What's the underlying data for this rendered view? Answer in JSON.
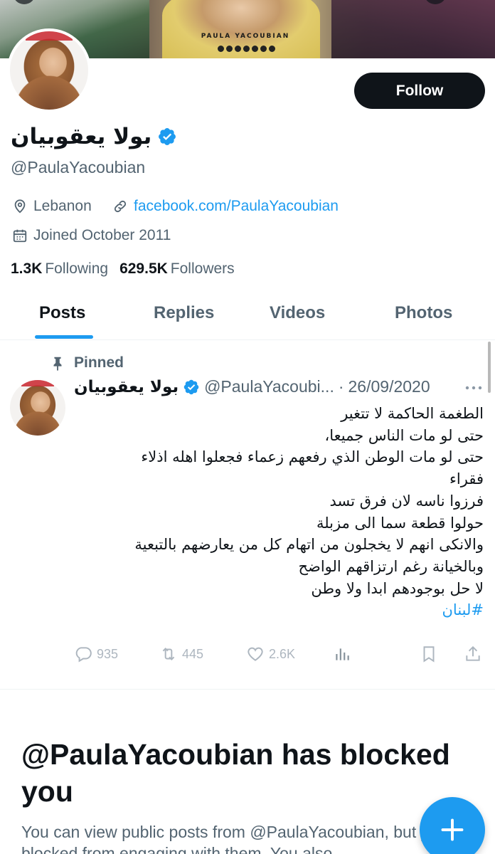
{
  "banner": {
    "brand_text": "PAULA YACOUBIAN"
  },
  "profile": {
    "display_name": "بولا يعقوبيان",
    "handle": "@PaulaYacoubian",
    "location": "Lebanon",
    "website": "facebook.com/PaulaYacoubian",
    "joined": "Joined October 2011",
    "following_count": "1.3K",
    "following_label": "Following",
    "followers_count": "629.5K",
    "followers_label": "Followers"
  },
  "follow_button": {
    "label": "Follow"
  },
  "tabs": [
    {
      "label": "Posts",
      "active": true
    },
    {
      "label": "Replies",
      "active": false
    },
    {
      "label": "Videos",
      "active": false
    },
    {
      "label": "Photos",
      "active": false
    }
  ],
  "pinned_post": {
    "pinned_label": "Pinned",
    "author_name": "بولا يعقوبيان",
    "author_handle": "@PaulaYacoubi...",
    "separator": "·",
    "date": "26/09/2020",
    "body_lines": [
      "الطغمة الحاكمة لا تتغير",
      "حتى لو مات الناس جميعا،",
      "حتى لو مات الوطن الذي رفعهم زعماء فجعلوا اهله اذلاء",
      "فقراء",
      "فرزوا ناسه لان فرق تسد",
      "حولوا قطعة سما الى مزبلة",
      "والانكى انهم لا يخجلون من اتهام كل من يعارضهم بالتبعية",
      "وبالخيانة رغم ارتزاقهم الواضح",
      "لا حل بوجودهم ابدا ولا وطن"
    ],
    "hashtag": "#لبنان",
    "replies": "935",
    "reposts": "445",
    "likes": "2.6K"
  },
  "blocked": {
    "title": "@PaulaYacoubian has blocked you",
    "description": "You can view public posts from @PaulaYacoubian, but you are blocked from engaging with them. You also"
  },
  "icons": {
    "location": "location-pin-icon",
    "link": "link-icon",
    "calendar": "calendar-icon",
    "verified": "verified-badge-icon",
    "pin": "pin-icon",
    "more": "more-dots-icon",
    "reply": "reply-icon",
    "repost": "repost-icon",
    "like": "heart-icon",
    "views": "analytics-icon",
    "bookmark": "bookmark-icon",
    "share": "share-icon",
    "compose": "plus-icon"
  },
  "colors": {
    "accent": "#1d9bf0",
    "text": "#0f1419",
    "secondary": "#536471"
  }
}
